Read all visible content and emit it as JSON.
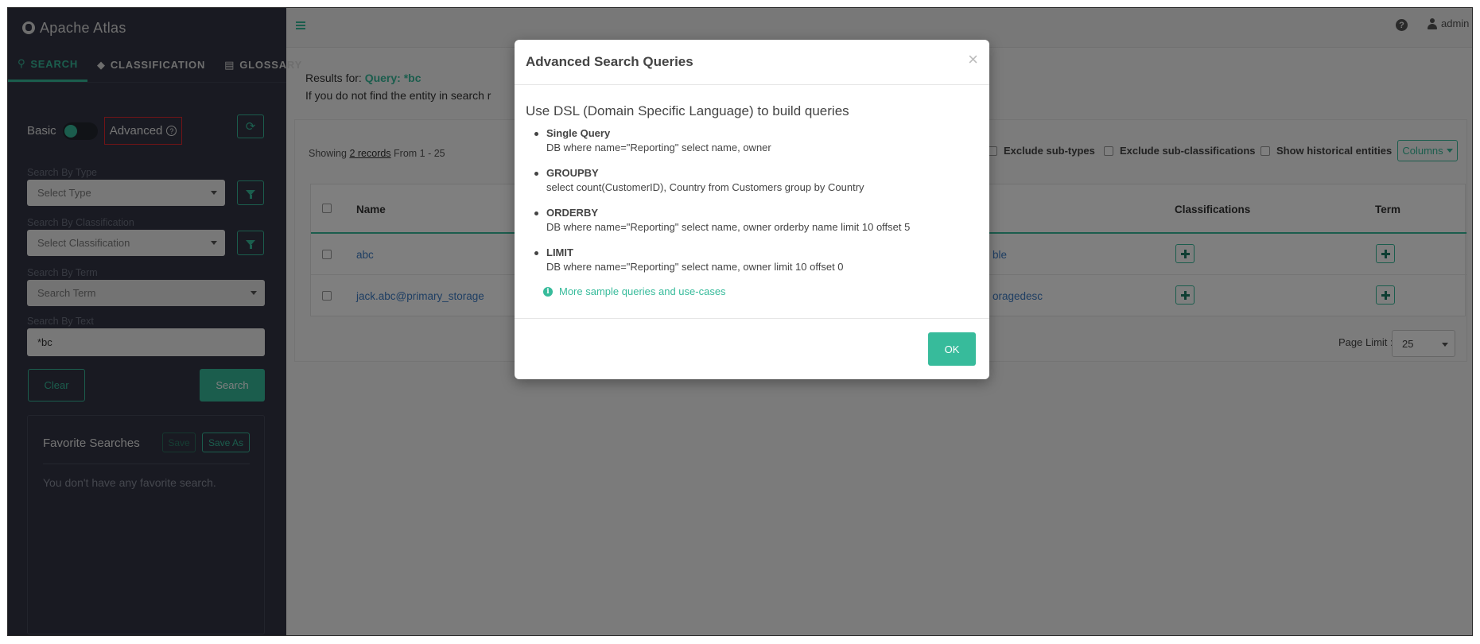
{
  "app": {
    "title": "Apache Atlas"
  },
  "sidebar": {
    "tabs": [
      {
        "label": "SEARCH",
        "icon": "search-icon"
      },
      {
        "label": "CLASSIFICATION",
        "icon": "tag-icon"
      },
      {
        "label": "GLOSSARY",
        "icon": "folder-open-icon"
      }
    ],
    "toggle": {
      "basic_label": "Basic",
      "advanced_label": "Advanced",
      "help_glyph": "?"
    },
    "type_filter": {
      "label": "Search By Type",
      "placeholder": "Select Type"
    },
    "classification_filter": {
      "label": "Search By Classification",
      "placeholder": "Select Classification"
    },
    "term_filter": {
      "label": "Search By Term",
      "placeholder": "Search Term"
    },
    "text_filter": {
      "label": "Search By Text",
      "value": "*bc"
    },
    "clear_label": "Clear",
    "search_label": "Search",
    "favorites": {
      "title": "Favorite Searches",
      "save_label": "Save",
      "save_as_label": "Save As",
      "empty_text": "You don't have any favorite search."
    }
  },
  "topbar": {
    "help_glyph": "?",
    "user": "admin"
  },
  "results": {
    "prefix": "Results for: ",
    "query": "Query: *bc",
    "hint": "If you do not find the entity in search r",
    "showing_prefix": "Showing ",
    "showing_count": "2 records",
    "showing_suffix": " From 1 - 25",
    "options": [
      "Exclude sub-types",
      "Exclude sub-classifications",
      "Show historical entities"
    ],
    "columns_label": "Columns",
    "table": {
      "headers": {
        "name": "Name",
        "classifications": "Classifications",
        "term": "Term"
      },
      "rows": [
        {
          "name": "abc",
          "type_fragment": "ble"
        },
        {
          "name": "jack.abc@primary_storage",
          "type_fragment": "oragedesc"
        }
      ]
    },
    "page_limit_label": "Page Limit :",
    "page_limit_value": "25"
  },
  "modal": {
    "title": "Advanced Search Queries",
    "close_glyph": "×",
    "lead": "Use DSL (Domain Specific Language) to build queries",
    "queries": [
      {
        "name": "Single Query",
        "code": "DB where name=\"Reporting\" select name, owner"
      },
      {
        "name": "GROUPBY",
        "code": "select count(CustomerID), Country from Customers group by Country"
      },
      {
        "name": "ORDERBY",
        "code": "DB where name=\"Reporting\" select name, owner orderby name limit 10 offset 5"
      },
      {
        "name": "LIMIT",
        "code": "DB where name=\"Reporting\" select name, owner limit 10 offset 0"
      }
    ],
    "more_link": "More sample queries and use-cases",
    "info_glyph": "i",
    "ok_label": "OK"
  },
  "colors": {
    "accent": "#37bb9b",
    "sidebar_bg": "#323544",
    "link": "#3c7cc6",
    "highlight_border": "#e0282e"
  }
}
